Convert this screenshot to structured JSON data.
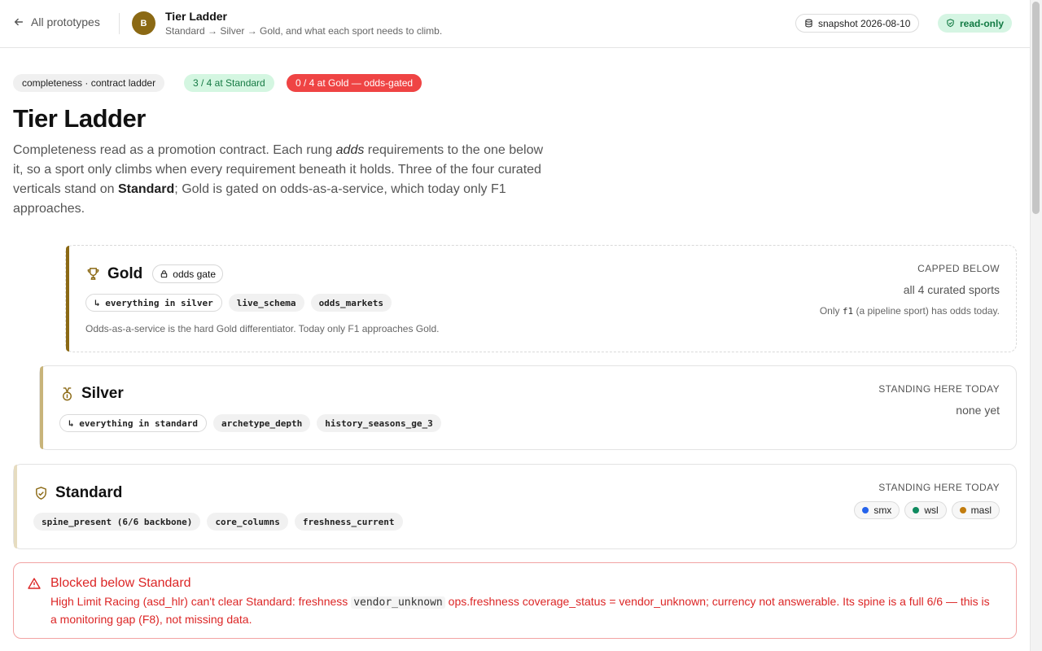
{
  "header": {
    "back_label": "All prototypes",
    "avatar_initial": "B",
    "title": "Tier Ladder",
    "subtitle": "Standard → Silver → Gold, and what each sport needs to climb.",
    "snapshot": "snapshot 2026-08-10",
    "mode": "read-only"
  },
  "badges": {
    "category": "completeness · contract ladder",
    "standard_status": "3 / 4 at Standard",
    "gold_status": "0 / 4 at Gold — odds-gated"
  },
  "page": {
    "title": "Tier Ladder",
    "intro_1": "Completeness read as a promotion contract. Each rung ",
    "intro_em": "adds",
    "intro_2": " requirements to the one below it, so a sport only climbs when every requirement beneath it holds. Three of the four curated verticals stand on ",
    "intro_strong": "Standard",
    "intro_3": "; Gold is gated on odds-as-a-service, which today only F1 approaches."
  },
  "tiers": {
    "gold": {
      "name": "Gold",
      "gate_label": "odds gate",
      "chips": [
        "↳ everything in silver",
        "live_schema",
        "odds_markets"
      ],
      "note": "Odds-as-a-service is the hard Gold differentiator. Today only F1 approaches Gold.",
      "status_label": "CAPPED BELOW",
      "status_value": "all 4 curated sports",
      "status_note_pre": "Only ",
      "status_note_code": "f1",
      "status_note_post": " (a pipeline sport) has odds today."
    },
    "silver": {
      "name": "Silver",
      "chips": [
        "↳ everything in standard",
        "archetype_depth",
        "history_seasons_ge_3"
      ],
      "status_label": "STANDING HERE TODAY",
      "status_value": "none yet"
    },
    "standard": {
      "name": "Standard",
      "chips": [
        "spine_present (6/6 backbone)",
        "core_columns",
        "freshness_current"
      ],
      "status_label": "STANDING HERE TODAY",
      "sports": [
        {
          "name": "smx",
          "color": "#2563eb"
        },
        {
          "name": "wsl",
          "color": "#0f8a5f"
        },
        {
          "name": "masl",
          "color": "#c27c0e"
        }
      ]
    }
  },
  "alert": {
    "title": "Blocked below Standard",
    "sport_name": "High Limit Racing",
    "body_1": " (asd_hlr) can't clear Standard: freshness ",
    "code": "vendor_unknown",
    "body_2": " ops.freshness coverage_status = vendor_unknown; currency not answerable. Its spine is a full 6/6 — this is a monitoring gap (F8), not missing data."
  },
  "colors": {
    "gold": "#8b6914",
    "silver": "#c8b47a",
    "standard": "#e6dcc0",
    "danger": "#dc2626",
    "success_bg": "#d4f6e1"
  }
}
